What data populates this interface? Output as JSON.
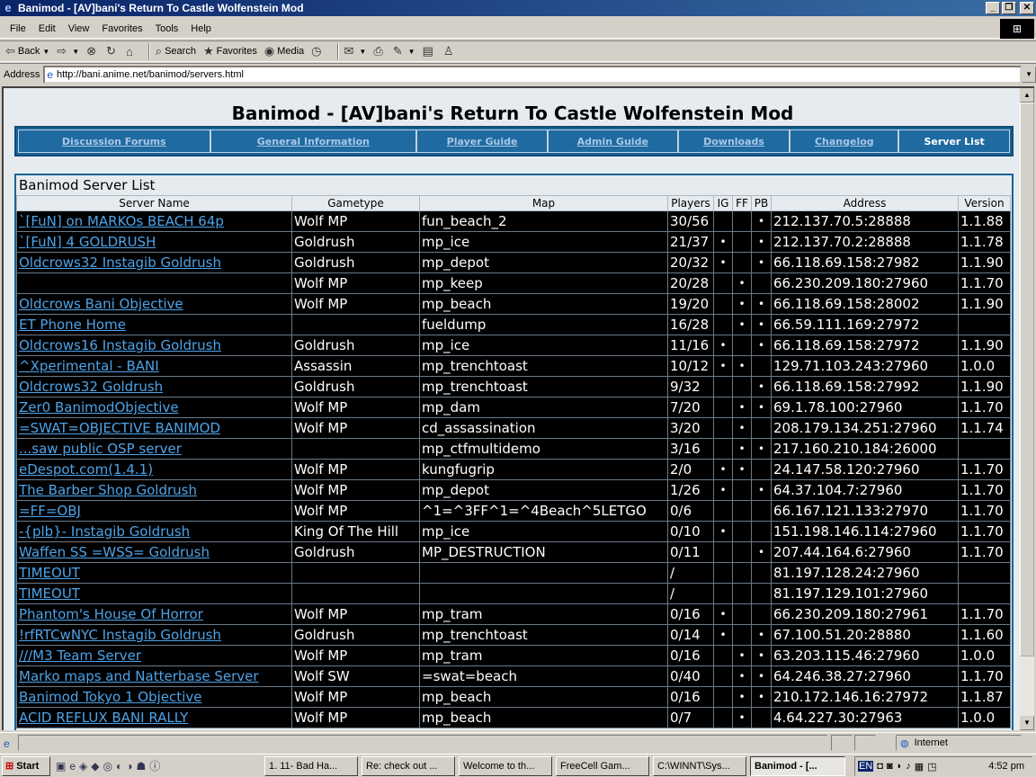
{
  "window": {
    "title": "Banimod - [AV]bani's Return To Castle Wolfenstein Mod"
  },
  "menu": [
    "File",
    "Edit",
    "View",
    "Favorites",
    "Tools",
    "Help"
  ],
  "toolbar": {
    "back": "Back",
    "search": "Search",
    "favorites": "Favorites",
    "media": "Media"
  },
  "address": {
    "label": "Address",
    "url": "http://bani.anime.net/banimod/servers.html"
  },
  "page": {
    "title": "Banimod - [AV]bani's Return To Castle Wolfenstein Mod",
    "nav": [
      "Discussion Forums",
      "General Information",
      "Player Guide",
      "Admin Guide",
      "Downloads",
      "Changelog"
    ],
    "nav_active": "Server List",
    "list_title": "Banimod Server List",
    "columns": [
      "Server Name",
      "Gametype",
      "Map",
      "Players",
      "IG",
      "FF",
      "PB",
      "Address",
      "Version"
    ],
    "rows": [
      [
        "`[FuN] on MARKOs BEACH 64p",
        "Wolf MP",
        "fun_beach_2",
        "30/56",
        "",
        "",
        "•",
        "212.137.70.5:28888",
        "1.1.88"
      ],
      [
        "`[FuN] 4 GOLDRUSH",
        "Goldrush",
        "mp_ice",
        "21/37",
        "•",
        "",
        "•",
        "212.137.70.2:28888",
        "1.1.78"
      ],
      [
        "Oldcrows32 Instagib Goldrush",
        "Goldrush",
        "mp_depot",
        "20/32",
        "•",
        "",
        "•",
        "66.118.69.158:27982",
        "1.1.90"
      ],
      [
        "",
        "Wolf MP",
        "mp_keep",
        "20/28",
        "",
        "•",
        "",
        "66.230.209.180:27960",
        "1.1.70"
      ],
      [
        "Oldcrows Bani Objective",
        "Wolf MP",
        "mp_beach",
        "19/20",
        "",
        "•",
        "•",
        "66.118.69.158:28002",
        "1.1.90"
      ],
      [
        "ET Phone Home",
        "",
        "fueldump",
        "16/28",
        "",
        "•",
        "•",
        "66.59.111.169:27972",
        ""
      ],
      [
        "Oldcrows16 Instagib Goldrush",
        "Goldrush",
        "mp_ice",
        "11/16",
        "•",
        "",
        "•",
        "66.118.69.158:27972",
        "1.1.90"
      ],
      [
        "^Xperimental - BANI",
        "Assassin",
        "mp_trenchtoast",
        "10/12",
        "•",
        "•",
        "",
        "129.71.103.243:27960",
        "1.0.0"
      ],
      [
        "Oldcrows32 Goldrush",
        "Goldrush",
        "mp_trenchtoast",
        "9/32",
        "",
        "",
        "•",
        "66.118.69.158:27992",
        "1.1.90"
      ],
      [
        "Zer0 BanimodObjective",
        "Wolf MP",
        "mp_dam",
        "7/20",
        "",
        "•",
        "•",
        "69.1.78.100:27960",
        "1.1.70"
      ],
      [
        "=SWAT=OBJECTIVE BANIMOD",
        "Wolf MP",
        "cd_assassination",
        "3/20",
        "",
        "•",
        "",
        "208.179.134.251:27960",
        "1.1.74"
      ],
      [
        "...saw public OSP server",
        "",
        "mp_ctfmultidemo",
        "3/16",
        "",
        "•",
        "•",
        "217.160.210.184:26000",
        ""
      ],
      [
        "eDespot.com(1.4.1)",
        "Wolf MP",
        "kungfugrip",
        "2/0",
        "•",
        "•",
        "",
        "24.147.58.120:27960",
        "1.1.70"
      ],
      [
        "The Barber Shop Goldrush",
        "Wolf MP",
        "mp_depot",
        "1/26",
        "•",
        "",
        "•",
        "64.37.104.7:27960",
        "1.1.70"
      ],
      [
        "=FF=OBJ",
        "Wolf MP",
        "^1=^3FF^1=^4Beach^5LETGO",
        "0/6",
        "",
        "",
        "",
        "66.167.121.133:27970",
        "1.1.70"
      ],
      [
        "-{plb}- Instagib Goldrush",
        "King Of The Hill",
        "mp_ice",
        "0/10",
        "•",
        "",
        "",
        "151.198.146.114:27960",
        "1.1.70"
      ],
      [
        "Waffen SS =WSS= Goldrush",
        "Goldrush",
        "MP_DESTRUCTION",
        "0/11",
        "",
        "",
        "•",
        "207.44.164.6:27960",
        "1.1.70"
      ],
      [
        "TIMEOUT",
        "",
        "",
        "/",
        "",
        "",
        "",
        "81.197.128.24:27960",
        ""
      ],
      [
        "TIMEOUT",
        "",
        "",
        "/",
        "",
        "",
        "",
        "81.197.129.101:27960",
        ""
      ],
      [
        "Phantom's House Of Horror",
        "Wolf MP",
        "mp_tram",
        "0/16",
        "•",
        "",
        "",
        "66.230.209.180:27961",
        "1.1.70"
      ],
      [
        "!rfRTCwNYC Instagib Goldrush",
        "Goldrush",
        "mp_trenchtoast",
        "0/14",
        "•",
        "",
        "•",
        "67.100.51.20:28880",
        "1.1.60"
      ],
      [
        "///M3 Team Server",
        "Wolf MP",
        "mp_tram",
        "0/16",
        "",
        "•",
        "•",
        "63.203.115.46:27960",
        "1.0.0"
      ],
      [
        "Marko maps and Natterbase Server",
        "Wolf SW",
        "=swat=beach",
        "0/40",
        "",
        "•",
        "•",
        "64.246.38.27:27960",
        "1.1.70"
      ],
      [
        "Banimod Tokyo 1 Objective",
        "Wolf MP",
        "mp_beach",
        "0/16",
        "",
        "•",
        "•",
        "210.172.146.16:27972",
        "1.1.87"
      ],
      [
        "ACID REFLUX BANI RALLY",
        "Wolf MP",
        "mp_beach",
        "0/7",
        "",
        "•",
        "",
        "4.64.227.30:27963",
        "1.0.0"
      ]
    ]
  },
  "status": {
    "zone": "Internet"
  },
  "taskbar": {
    "start": "Start",
    "tasks": [
      "1. 11- Bad Ha...",
      "Re: check out ...",
      "Welcome to th...",
      "FreeCell Gam...",
      "C:\\WINNT\\Sys...",
      "Banimod - [..."
    ],
    "lang": "EN",
    "time": "4:52 pm"
  }
}
